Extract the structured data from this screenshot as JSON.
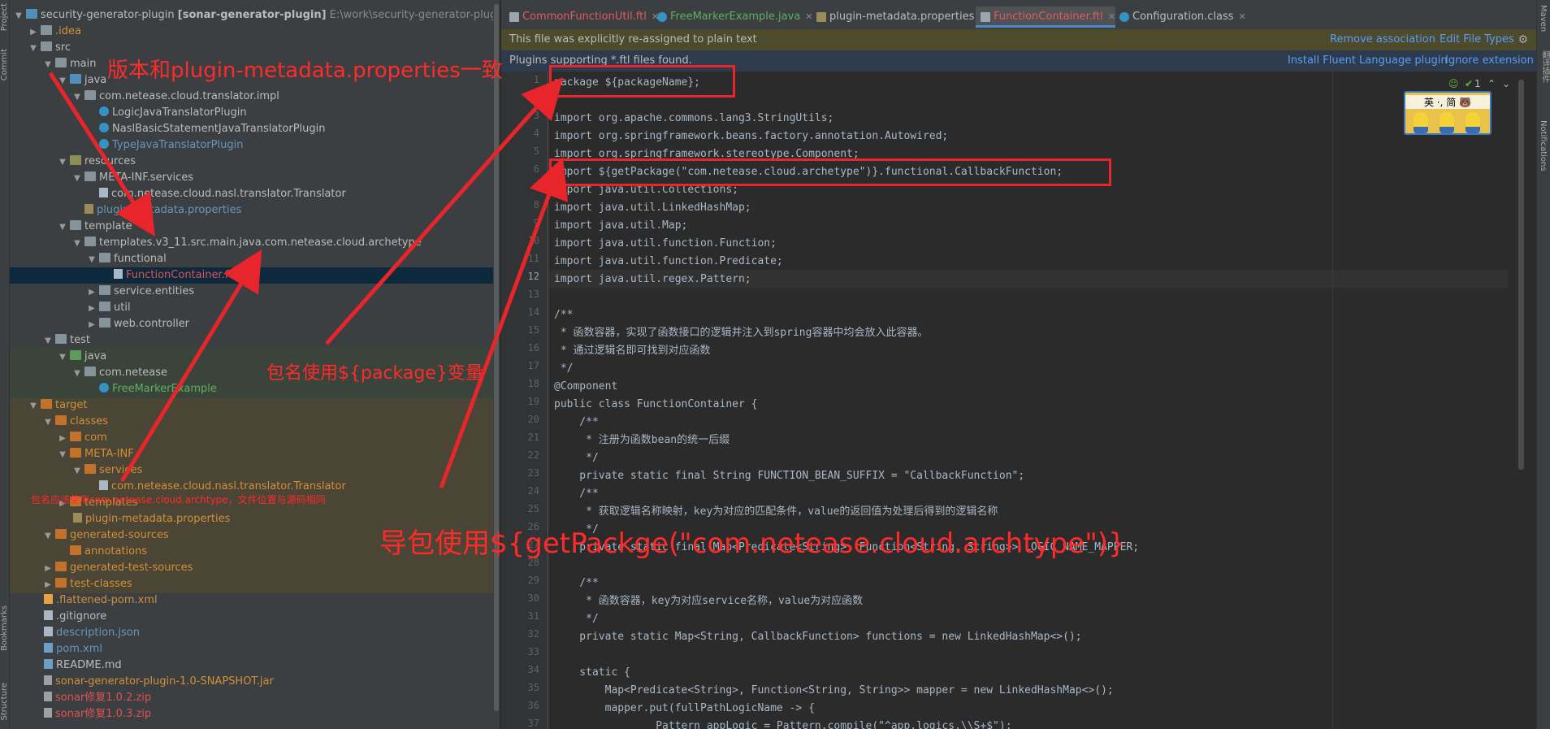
{
  "left_stripe": {
    "project_label": "Project",
    "commit_label": "Commit",
    "bookmarks_label": "Bookmarks",
    "structure_label": "Structure"
  },
  "tree": {
    "root": {
      "name": "security-generator-plugin",
      "module": "[sonar-generator-plugin]",
      "path": "E:\\work\\security-generator-plugin"
    },
    "idea": ".idea",
    "src": "src",
    "main": "main",
    "java": "java",
    "impl_pkg": "com.netease.cloud.translator.impl",
    "cls1": "LogicJavaTranslatorPlugin",
    "cls2": "NaslBasicStatementJavaTranslatorPlugin",
    "cls3": "TypeJavaTranslatorPlugin",
    "resources": "resources",
    "meta_inf_services": "META-INF.services",
    "translator_file": "com.netease.cloud.nasl.translator.Translator",
    "plugin_props": "plugin-metadata.properties",
    "template": "template",
    "templates_pkg": "templates.v3_11.src.main.java.com.netease.cloud.archetype",
    "functional": "functional",
    "function_container": "FunctionContainer.ftl",
    "service_entities": "service.entities",
    "util": "util",
    "web_controller": "web.controller",
    "test": "test",
    "test_java": "java",
    "com_netease": "com.netease",
    "freemarker_example": "FreeMarkerExample",
    "target": "target",
    "classes": "classes",
    "com": "com",
    "meta_inf": "META-INF",
    "services": "services",
    "target_translator": "com.netease.cloud.nasl.translator.Translator",
    "templates": "templates",
    "target_props": "plugin-metadata.properties",
    "generated_sources": "generated-sources",
    "annotations": "annotations",
    "generated_test_sources": "generated-test-sources",
    "test_classes": "test-classes",
    "flattened_pom": ".flattened-pom.xml",
    "gitignore": ".gitignore",
    "description_json": "description.json",
    "pom": "pom.xml",
    "readme": "README.md",
    "jar": "sonar-generator-plugin-1.0-SNAPSHOT.jar",
    "zip1": "sonar修复1.0.2.zip",
    "zip2": "sonar修复1.0.3.zip"
  },
  "tabs": [
    {
      "label": "CommonFunctionUtil.ftl"
    },
    {
      "label": "FreeMarkerExample.java"
    },
    {
      "label": "plugin-metadata.properties"
    },
    {
      "label": "FunctionContainer.ftl"
    },
    {
      "label": "Configuration.class"
    }
  ],
  "notice1": {
    "text": "This file was explicitly re-assigned to plain text",
    "remove": "Remove association",
    "edit": "Edit File Types"
  },
  "notice2": {
    "text": "Plugins supporting *.ftl files found.",
    "install": "Install Fluent Language plugin",
    "ignore": "Ignore extension"
  },
  "inspections": {
    "count": "1"
  },
  "widget": {
    "label": "英 ·, 简 🐻"
  },
  "code_lines": [
    "package ${packageName};",
    "",
    "import org.apache.commons.lang3.StringUtils;",
    "import org.springframework.beans.factory.annotation.Autowired;",
    "import org.springframework.stereotype.Component;",
    "import ${getPackage(\"com.netease.cloud.archetype\")}.functional.CallbackFunction;",
    "import java.util.Collections;",
    "import java.util.LinkedHashMap;",
    "import java.util.Map;",
    "import java.util.function.Function;",
    "import java.util.function.Predicate;",
    "import java.util.regex.Pattern;",
    "",
    "/**",
    " * 函数容器，实现了函数接口的逻辑并注入到spring容器中均会放入此容器。",
    " * 通过逻辑名即可找到对应函数",
    " */",
    "@Component",
    "public class FunctionContainer {",
    "    /**",
    "     * 注册为函数bean的统一后缀",
    "     */",
    "    private static final String FUNCTION_BEAN_SUFFIX = \"CallbackFunction\";",
    "    /**",
    "     * 获取逻辑名称映射，key为对应的匹配条件，value的返回值为处理后得到的逻辑名称",
    "     */",
    "    private static final Map<Predicate<String>, Function<String, String>> LOGIC_NAME_MAPPER;",
    "",
    "    /**",
    "     * 函数容器，key为对应service名称，value为对应函数",
    "     */",
    "    private static Map<String, CallbackFunction> functions = new LinkedHashMap<>();",
    "",
    "    static {",
    "        Map<Predicate<String>, Function<String, String>> mapper = new LinkedHashMap<>();",
    "        mapper.put(fullPathLogicName -> {",
    "                Pattern appLogic = Pattern.compile(\"^app.logics.\\\\S+$\");"
  ],
  "line_numbers": [
    "1",
    "2",
    "3",
    "4",
    "5",
    "6",
    "7",
    "8",
    "9",
    "10",
    "11",
    "12",
    "13",
    "14",
    "15",
    "16",
    "17",
    "18",
    "19",
    "20",
    "21",
    "22",
    "23",
    "24",
    "25",
    "26",
    "27",
    "28",
    "29",
    "30",
    "31",
    "32",
    "33",
    "34",
    "35",
    "36",
    "37"
  ],
  "right_stripe": {
    "maven": "Maven",
    "translate": "翻译插件",
    "notifications": "Notifications"
  },
  "annotations": {
    "version_note": "版本和plugin-metadata.properties一致",
    "package_note": "包名使用${package}变量",
    "import_note": "导包使用${getPackge(\"com.netease.cloud.archtype\")}",
    "path_note": "包名应该使用com.netease.cloud.archtype，文件位置与源码相同"
  },
  "colors": {
    "annotation_red": "#e8252b",
    "link_blue": "#589df6",
    "selected_row": "#0d293e",
    "tab_accent": "#4a88c7"
  }
}
